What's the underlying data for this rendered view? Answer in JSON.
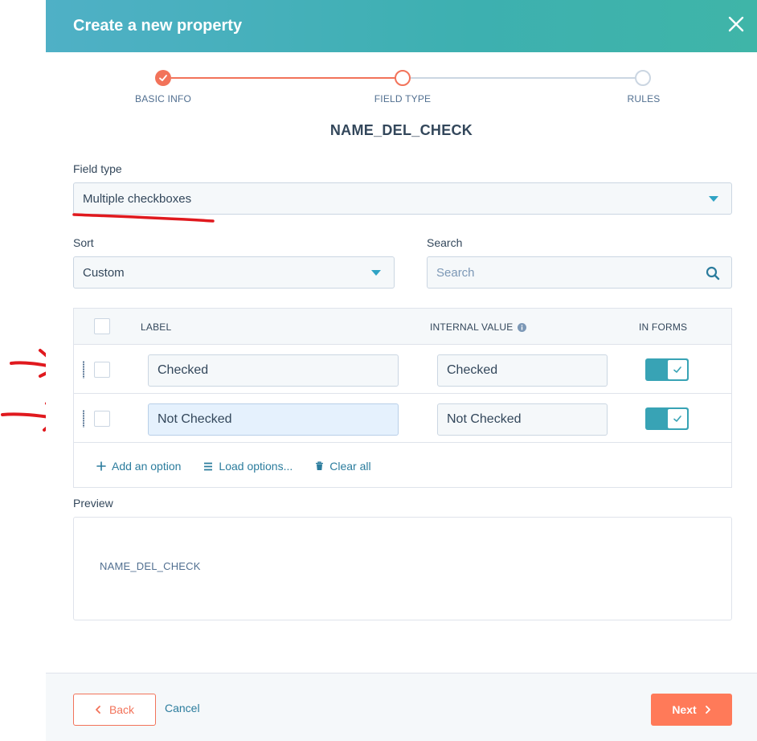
{
  "header": {
    "title": "Create a new property"
  },
  "stepper": {
    "steps": [
      {
        "label": "BASIC INFO",
        "state": "complete"
      },
      {
        "label": "FIELD TYPE",
        "state": "current"
      },
      {
        "label": "RULES",
        "state": "upcoming"
      }
    ]
  },
  "property_name": "NAME_DEL_CHECK",
  "field_type": {
    "label": "Field type",
    "value": "Multiple checkboxes"
  },
  "sort": {
    "label": "Sort",
    "value": "Custom"
  },
  "search": {
    "label": "Search",
    "placeholder": "Search"
  },
  "options_table": {
    "columns": {
      "label": "LABEL",
      "internal_value": "INTERNAL VALUE",
      "in_forms": "IN FORMS"
    },
    "rows": [
      {
        "label": "Checked",
        "internal_value": "Checked",
        "in_forms": true
      },
      {
        "label": "Not Checked",
        "internal_value": "Not Checked",
        "in_forms": true
      }
    ],
    "actions": {
      "add": "Add an option",
      "load": "Load options...",
      "clear": "Clear all"
    }
  },
  "preview": {
    "label": "Preview",
    "content": "NAME_DEL_CHECK"
  },
  "footer": {
    "back": "Back",
    "cancel": "Cancel",
    "next": "Next"
  },
  "colors": {
    "header_gradient_start": "#4fb0c6",
    "header_gradient_end": "#3fb5a8",
    "primary_orange": "#ff7a59",
    "link_teal": "#2b7c9d",
    "toggle_on": "#38a3b5",
    "annotation_red": "#e0191e"
  }
}
